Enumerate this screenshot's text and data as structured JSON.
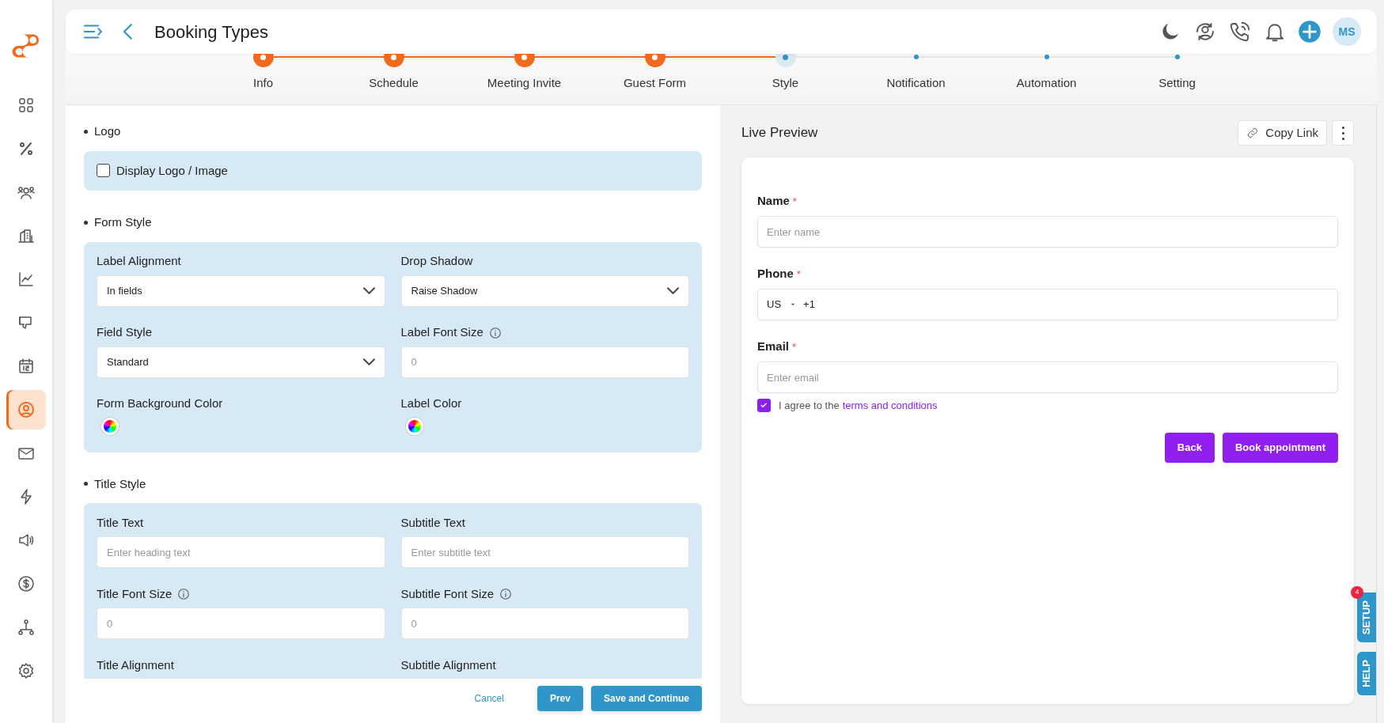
{
  "sidebar": {
    "items": [
      {
        "kind": "grid",
        "selected": false
      },
      {
        "kind": "percent",
        "selected": false
      },
      {
        "kind": "people",
        "selected": false
      },
      {
        "kind": "building",
        "selected": false
      },
      {
        "kind": "chart",
        "selected": false
      },
      {
        "kind": "dislike",
        "selected": false
      },
      {
        "kind": "calendar",
        "selected": false
      },
      {
        "kind": "user",
        "selected": true
      },
      {
        "kind": "mail",
        "selected": false
      },
      {
        "kind": "bolt",
        "selected": false
      },
      {
        "kind": "speaker",
        "selected": false
      },
      {
        "kind": "dollar",
        "selected": false
      },
      {
        "kind": "tree",
        "selected": false
      },
      {
        "kind": "gear",
        "selected": false
      }
    ]
  },
  "header": {
    "title": "Booking Types",
    "avatar": "MS"
  },
  "steps": [
    {
      "label": "Info",
      "completed": true,
      "selected": false
    },
    {
      "label": "Schedule",
      "completed": true,
      "selected": false
    },
    {
      "label": "Meeting Invite",
      "completed": true,
      "selected": false
    },
    {
      "label": "Guest Form",
      "completed": true,
      "selected": false
    },
    {
      "label": "Style",
      "completed": false,
      "selected": true
    },
    {
      "label": "Notification",
      "completed": false,
      "selected": false
    },
    {
      "label": "Automation",
      "completed": false,
      "selected": false
    },
    {
      "label": "Setting",
      "completed": false,
      "selected": false
    }
  ],
  "form": {
    "sections": [
      {
        "title": "Logo",
        "checkbox": {
          "label": "Display Logo / Image",
          "checked": false
        }
      },
      {
        "title": "Form Style",
        "fields": [
          {
            "label": "Label Alignment",
            "kind": "select",
            "value": "In fields"
          },
          {
            "label": "Drop Shadow",
            "kind": "select",
            "value": "Raise Shadow"
          },
          {
            "label": "Field Style",
            "kind": "select",
            "value": "Standard"
          },
          {
            "label": "Label Font Size",
            "kind": "input",
            "info": true,
            "placeholder": "0"
          },
          {
            "label": "Form Background Color",
            "kind": "color"
          },
          {
            "label": "Label Color",
            "kind": "color"
          }
        ]
      },
      {
        "title": "Title Style",
        "fields": [
          {
            "label": "Title Text",
            "kind": "input",
            "placeholder": "Enter heading text"
          },
          {
            "label": "Subtitle Text",
            "kind": "input",
            "placeholder": "Enter subtitle text"
          },
          {
            "label": "Title Font Size",
            "kind": "input",
            "info": true,
            "placeholder": "0"
          },
          {
            "label": "Subtitle Font Size",
            "kind": "input",
            "info": true,
            "placeholder": "0"
          },
          {
            "label": "Title Alignment",
            "kind": "label"
          },
          {
            "label": "Subtitle Alignment",
            "kind": "label"
          }
        ]
      }
    ]
  },
  "footer": {
    "buttons": [
      {
        "label": "Cancel",
        "kind": "link"
      },
      {
        "label": "Prev",
        "kind": "primary"
      },
      {
        "label": "Save and Continue",
        "kind": "primary"
      }
    ]
  },
  "preview": {
    "title": "Live Preview",
    "copy_link": "Copy Link",
    "fields": [
      {
        "label": "Name",
        "required": "*",
        "kind": "text",
        "placeholder": "Enter name"
      },
      {
        "label": "Phone",
        "required": "*",
        "kind": "phone",
        "country": "US",
        "code": "+1"
      },
      {
        "label": "Email",
        "required": "*",
        "kind": "text",
        "placeholder": "Enter email"
      }
    ],
    "agree": {
      "checked": true,
      "text": "I agree to the",
      "link": "terms and conditions"
    },
    "buttons": [
      "Back",
      "Book appointment"
    ]
  },
  "side_tabs": [
    {
      "label": "SETUP",
      "badge": "4"
    },
    {
      "label": "HELP"
    }
  ]
}
